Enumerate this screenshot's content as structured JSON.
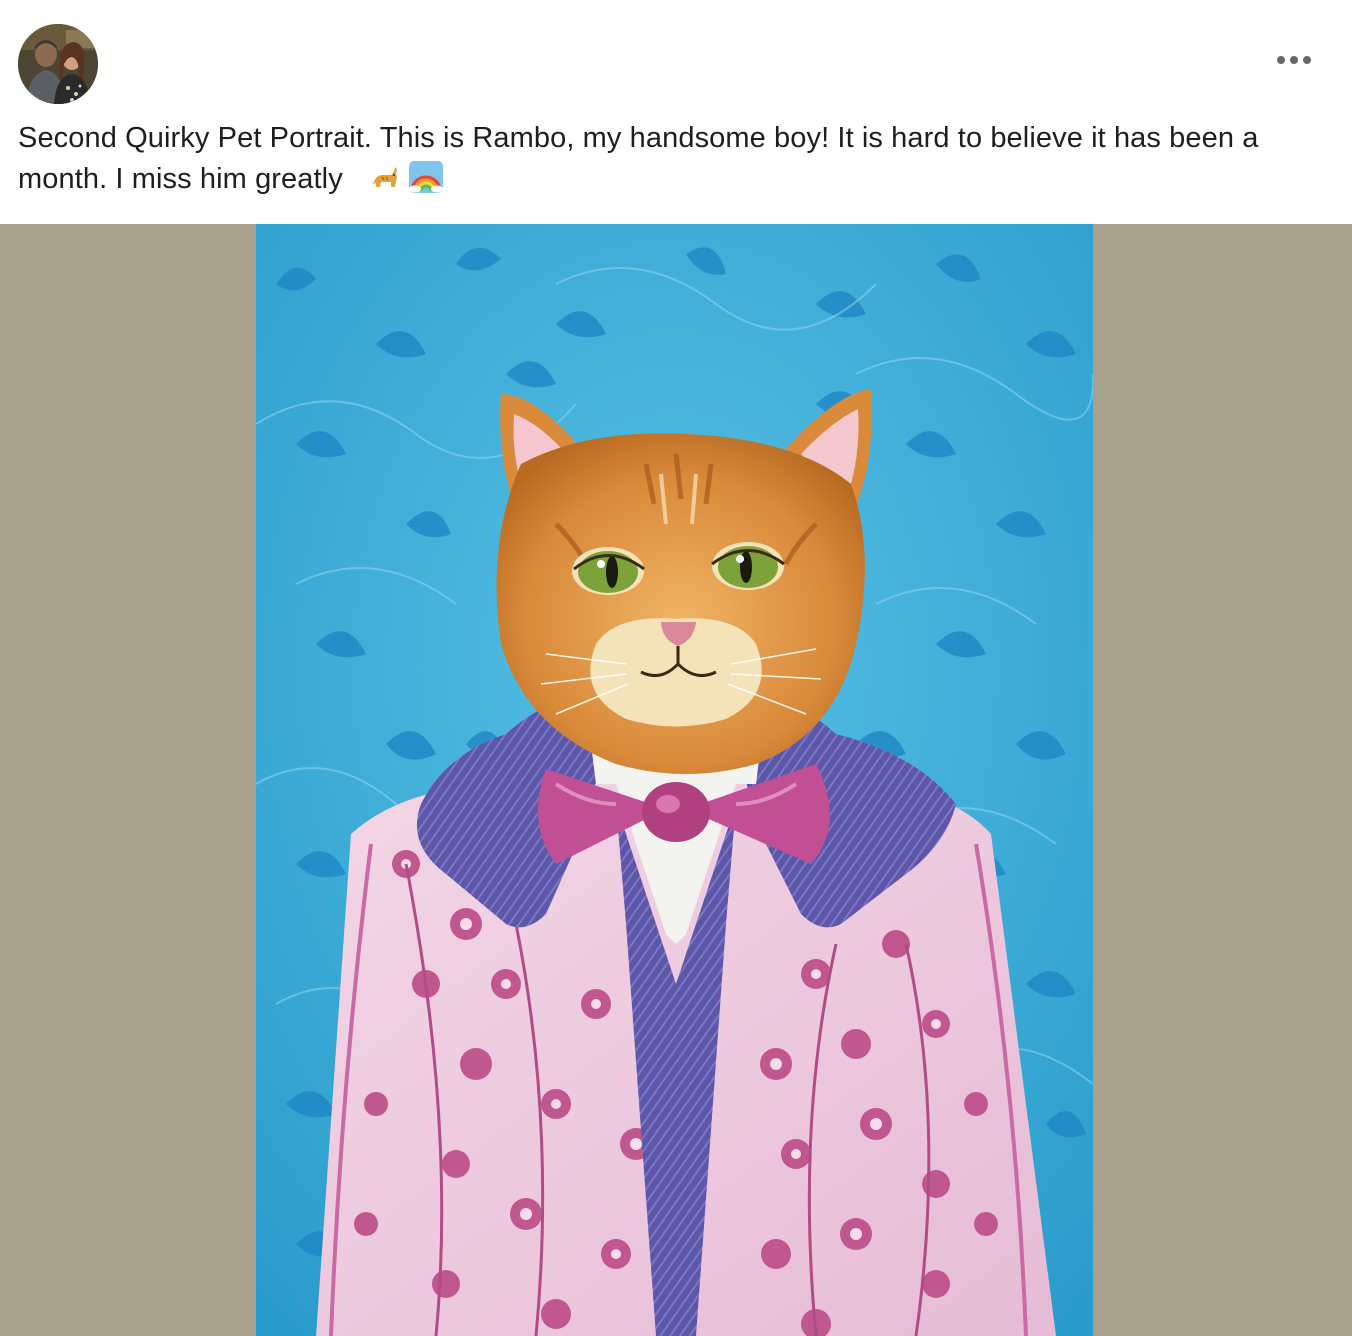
{
  "post": {
    "author_avatar": "profile-photo-couple",
    "more_icon": "more-horizontal-icon",
    "caption_text": "Second Quirky Pet Portrait. This is Rambo, my handsome boy! It is hard to believe it has been a month. I miss him greatly",
    "caption_emojis": [
      "cat-emoji-icon",
      "rainbow-emoji-icon"
    ]
  },
  "media": {
    "background_color": "#aaa08e",
    "subject": "painting-orange-cat-in-pink-floral-jacket"
  },
  "colors": {
    "painting_background": "#3aa9d4",
    "jacket_pink": "#ecc6dc",
    "collar_purple": "#5e58aa",
    "bowtie": "#c04f93",
    "cat_orange": "#d98a3a",
    "cat_eyes": "#7ea23a"
  }
}
